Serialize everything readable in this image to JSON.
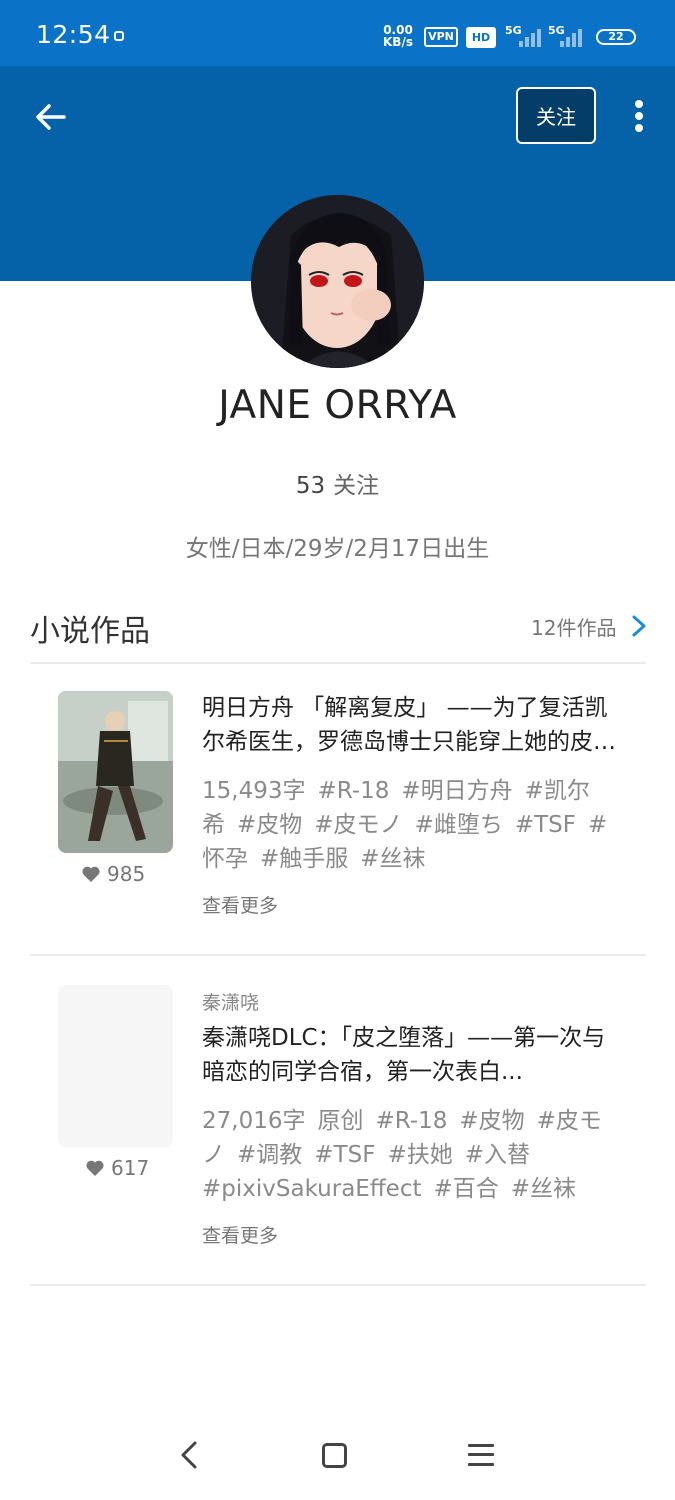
{
  "status_bar": {
    "time": "12:54",
    "speed_value": "0.00",
    "speed_unit": "KB/s",
    "vpn": "VPN",
    "hd": "HD",
    "net1": "5G",
    "net2": "5G",
    "battery": "22"
  },
  "header": {
    "follow_label": "关注",
    "back_icon": "arrow-left-icon",
    "more_icon": "more-vertical-icon"
  },
  "profile": {
    "name": "JANE ORRYA",
    "following_count": "53",
    "following_label": "关注",
    "info": "女性/日本/29岁/2月17日出生"
  },
  "section": {
    "title": "小说作品",
    "count_label": "12件作品"
  },
  "novels": [
    {
      "author": "",
      "title": "明日方舟 「解离复皮」 ——为了复活凯尔希医生，罗德岛博士只能穿上她的皮物...",
      "likes": "985",
      "word_count": "15,493字",
      "tags": [
        "#R-18",
        "#明日方舟",
        "#凯尔希",
        "#皮物",
        "#皮モノ",
        "#雌堕ち",
        "#TSF",
        "#怀孕",
        "#触手服",
        "#丝袜"
      ],
      "see_more": "查看更多"
    },
    {
      "author": "秦潇哓",
      "title": "秦潇哓DLC：「皮之堕落」——第一次与暗恋的同学合宿，第一次表白...",
      "likes": "617",
      "word_count": "27,016字",
      "tags": [
        "原创",
        "#R-18",
        "#皮物",
        "#皮モノ",
        "#调教",
        "#TSF",
        "#扶她",
        "#入替",
        "#pixivSakuraEffect",
        "#百合",
        "#丝袜"
      ],
      "see_more": "查看更多"
    }
  ],
  "colors": {
    "status_bar": "#0a73c7",
    "header": "#0662a8",
    "accent": "#1a8be0"
  }
}
